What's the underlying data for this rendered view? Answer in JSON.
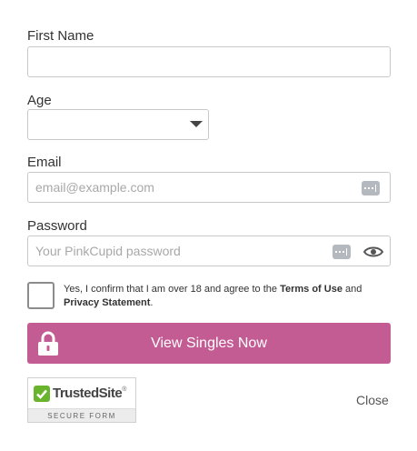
{
  "form": {
    "first_name_label": "First Name",
    "first_name_value": "",
    "age_label": "Age",
    "age_value": "",
    "email_label": "Email",
    "email_placeholder": "email@example.com",
    "password_label": "Password",
    "password_placeholder": "Your PinkCupid password"
  },
  "consent": {
    "prefix": "Yes, I confirm that I am over 18 and agree to the ",
    "terms_link": "Terms of Use",
    "connector": " and ",
    "privacy_link": "Privacy Statement",
    "suffix": "."
  },
  "cta": {
    "label": "View Singles Now"
  },
  "badge": {
    "name": "TrustedSite",
    "trademark": "®",
    "subtitle": "SECURE FORM"
  },
  "close_label": "Close",
  "colors": {
    "cta_background": "#c45c94",
    "check_green": "#6ab42d"
  },
  "icons": [
    "password-manager-icon",
    "show-password-eye-icon",
    "lock-icon",
    "dropdown-arrow-icon",
    "check-icon"
  ]
}
